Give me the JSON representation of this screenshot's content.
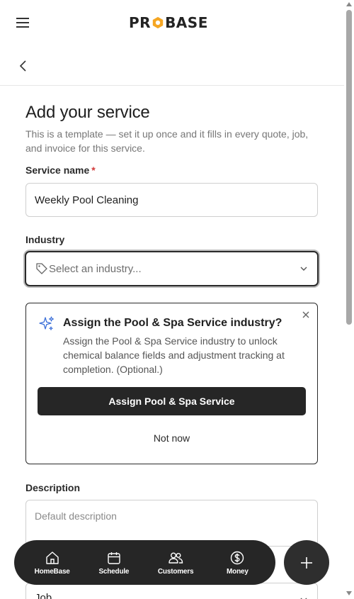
{
  "header": {
    "logo_text_left": "PR",
    "logo_text_right": "BASE",
    "accent_color": "#f5a623"
  },
  "page": {
    "title": "Add your service",
    "subtitle": "This is a template — set it up once and it fills in every quote, job, and invoice for this service."
  },
  "form": {
    "service_name_label": "Service name",
    "required_marker": "*",
    "service_name_value": "Weekly Pool Cleaning",
    "industry_label": "Industry",
    "industry_placeholder": "Select an industry...",
    "description_label": "Description",
    "description_placeholder": "Default description",
    "type_value": "Job"
  },
  "suggestion": {
    "title": "Assign the Pool & Spa Service industry?",
    "body": "Assign the Pool & Spa Service industry to unlock chemical balance fields and adjustment tracking at completion. (Optional.)",
    "primary_label": "Assign Pool & Spa Service",
    "secondary_label": "Not now"
  },
  "bottom_nav": {
    "items": [
      {
        "label": "HomeBase",
        "icon": "home-icon"
      },
      {
        "label": "Schedule",
        "icon": "calendar-icon"
      },
      {
        "label": "Customers",
        "icon": "users-icon"
      },
      {
        "label": "Money",
        "icon": "dollar-icon"
      }
    ],
    "fab_icon": "plus-icon"
  }
}
